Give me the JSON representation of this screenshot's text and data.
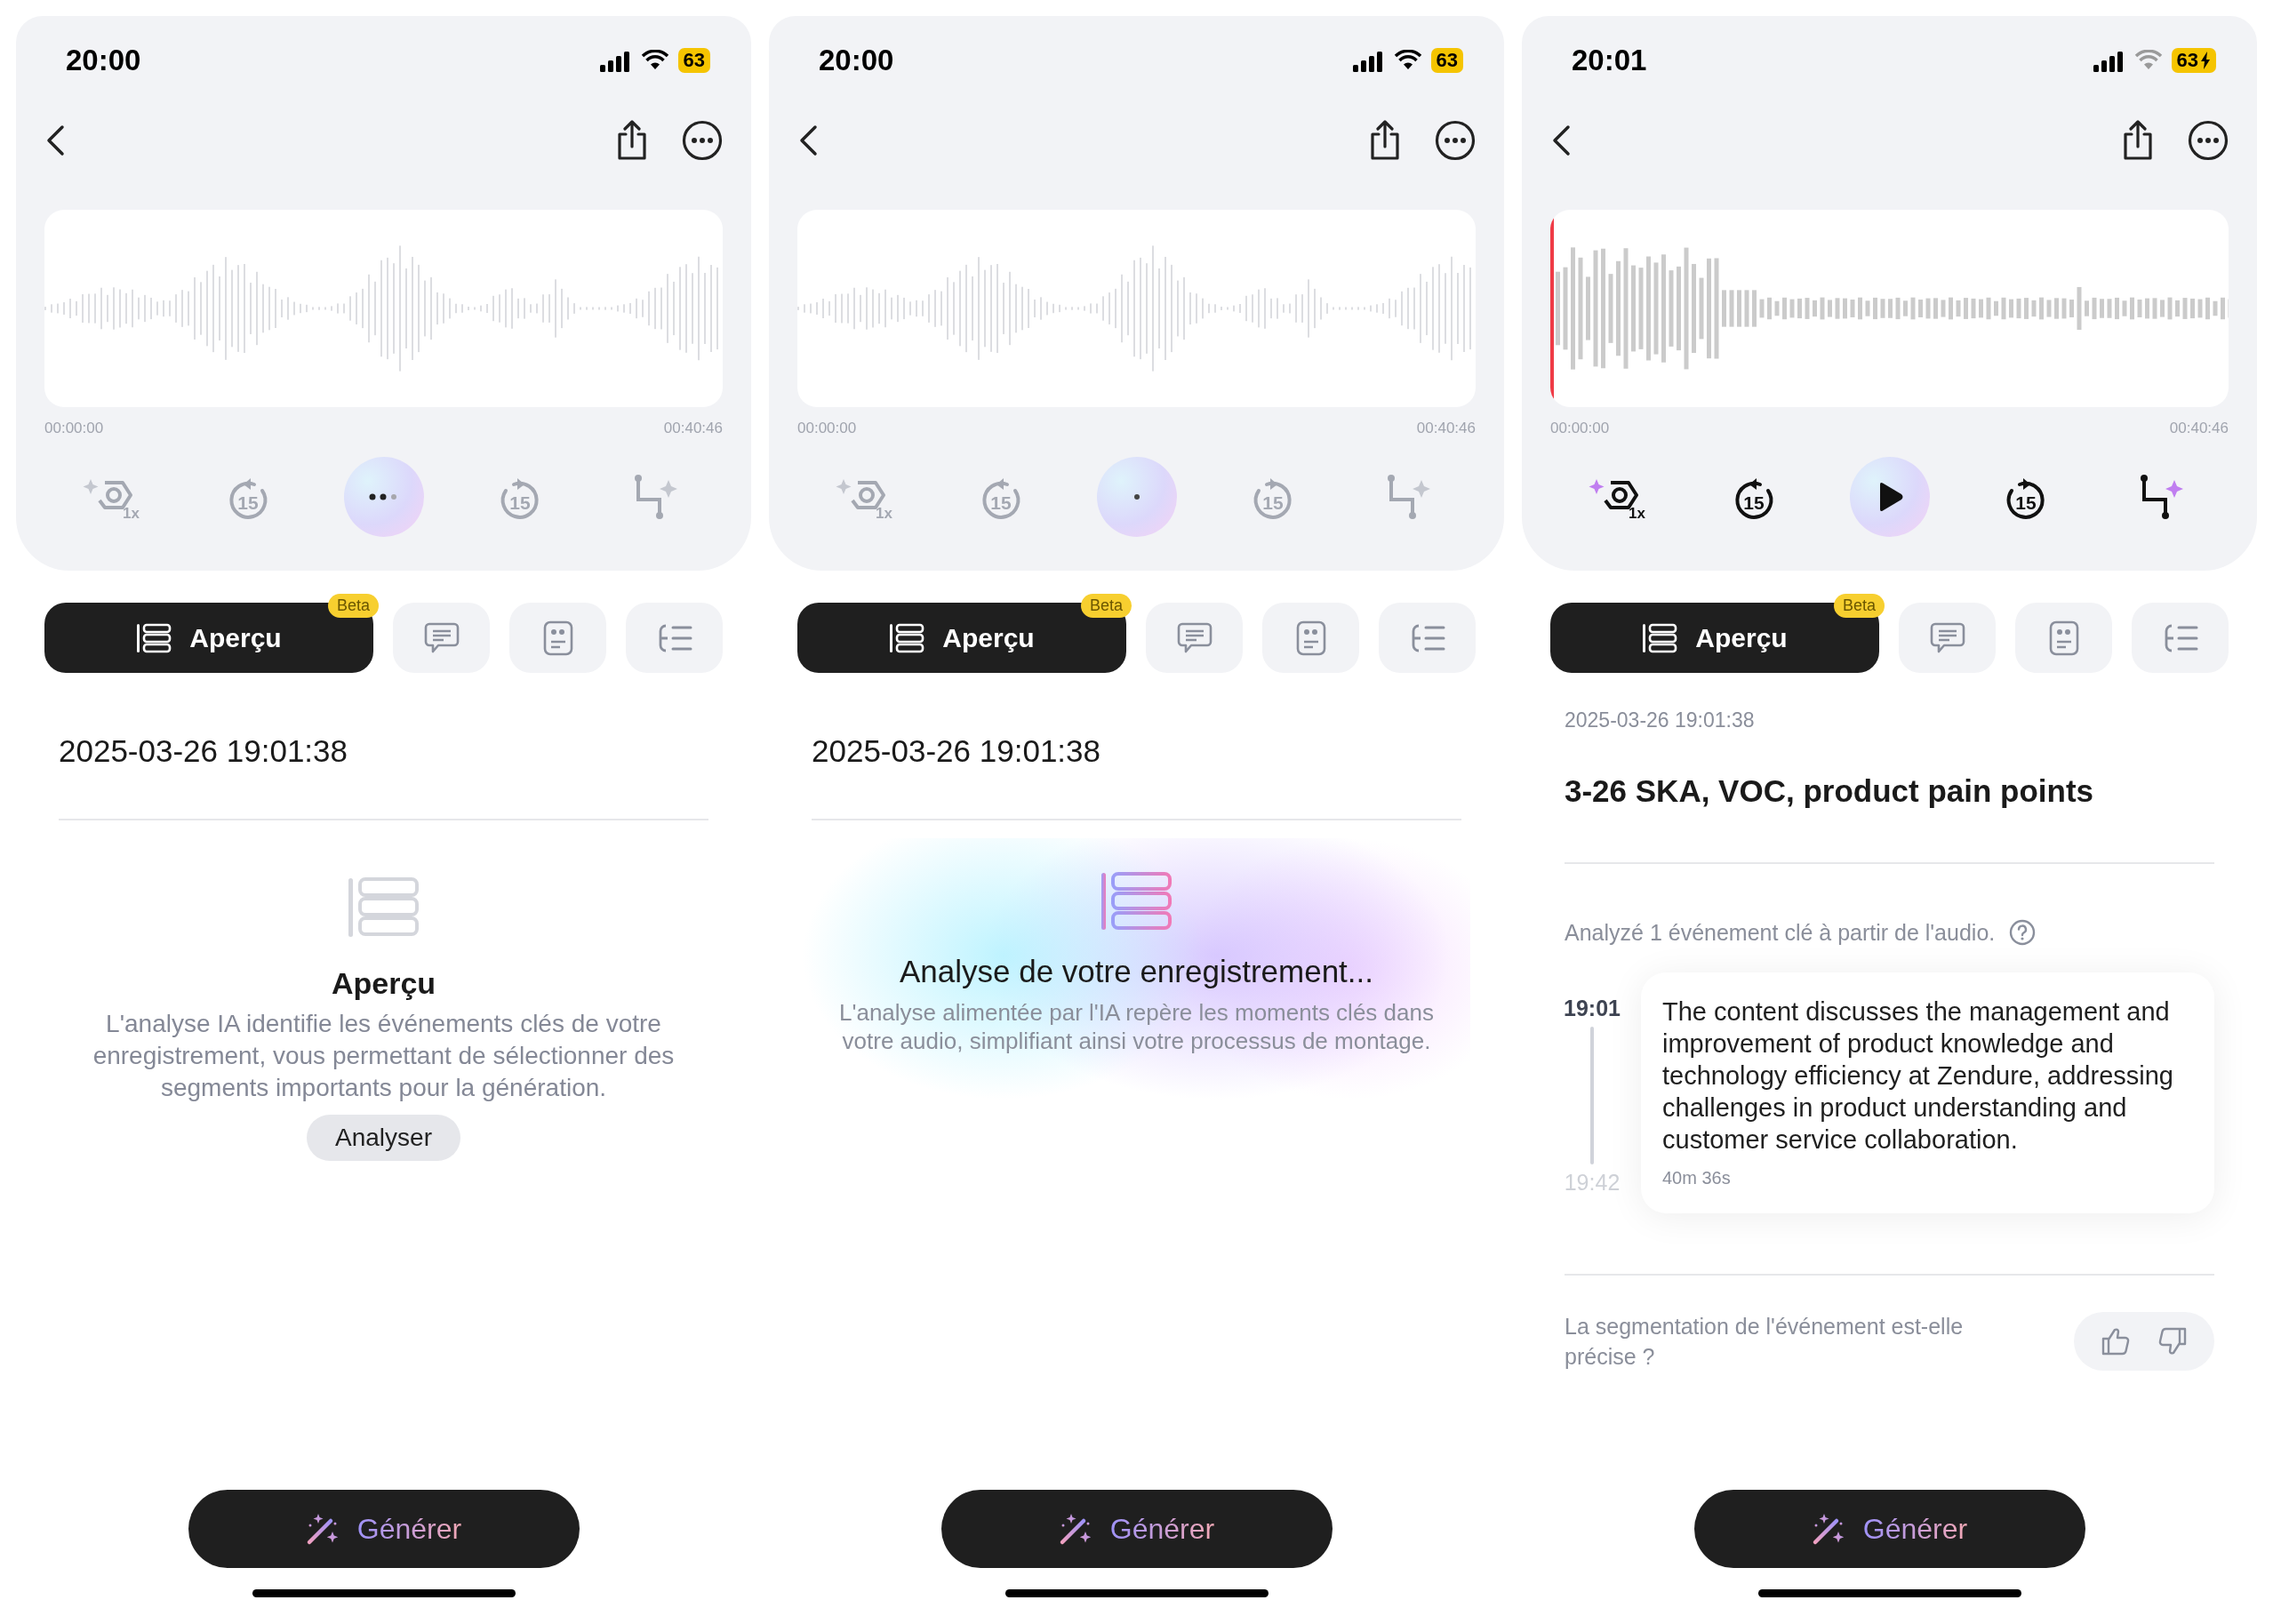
{
  "screens": [
    {
      "status": {
        "time": "20:00",
        "battery": "63",
        "charging": false
      },
      "player": {
        "enabled": false,
        "waveform": {
          "kind": "sparse",
          "playhead": false
        },
        "start_time": "00:00:00",
        "end_time": "00:40:46",
        "controls": [
          {
            "kind": "speed",
            "label": "1x"
          },
          {
            "kind": "rewind",
            "label": "15"
          },
          {
            "kind": "dots"
          },
          {
            "kind": "forward",
            "label": "15"
          },
          {
            "kind": "trim"
          }
        ]
      },
      "tabs": [
        {
          "kind": "overview",
          "label": "Aperçu",
          "badge": "Beta",
          "selected": true
        },
        {
          "kind": "chat",
          "selected": false
        },
        {
          "kind": "quote",
          "selected": false
        },
        {
          "kind": "outline",
          "selected": false
        }
      ],
      "content": {
        "kind": "empty",
        "date": "2025-03-26 19:01:38",
        "title": "Aperçu",
        "description": "L'analyse IA identifie les événements clés de votre enregistrement, vous permettant de sélectionner des segments importants pour la génération.",
        "button": "Analyser"
      },
      "generate": "Générer"
    },
    {
      "status": {
        "time": "20:00",
        "battery": "63",
        "charging": false
      },
      "player": {
        "enabled": false,
        "waveform": {
          "kind": "sparse",
          "playhead": false
        },
        "start_time": "00:00:00",
        "end_time": "00:40:46",
        "controls": [
          {
            "kind": "speed",
            "label": "1x"
          },
          {
            "kind": "rewind",
            "label": "15"
          },
          {
            "kind": "dot"
          },
          {
            "kind": "forward",
            "label": "15"
          },
          {
            "kind": "trim"
          }
        ]
      },
      "tabs": [
        {
          "kind": "overview",
          "label": "Aperçu",
          "badge": "Beta",
          "selected": true
        },
        {
          "kind": "chat",
          "selected": false
        },
        {
          "kind": "quote",
          "selected": false
        },
        {
          "kind": "outline",
          "selected": false
        }
      ],
      "content": {
        "kind": "loading",
        "date": "2025-03-26 19:01:38",
        "title": "Analyse de votre enregistrement...",
        "description": "L'analyse alimentée par l'IA repère les moments clés dans votre audio, simplifiant ainsi votre processus de montage."
      },
      "generate": "Générer"
    },
    {
      "status": {
        "time": "20:01",
        "battery": "63",
        "charging": true
      },
      "player": {
        "enabled": true,
        "waveform": {
          "kind": "dense",
          "playhead": true
        },
        "start_time": "00:00:00",
        "end_time": "00:40:46",
        "controls": [
          {
            "kind": "speed",
            "label": "1x"
          },
          {
            "kind": "rewind",
            "label": "15"
          },
          {
            "kind": "play"
          },
          {
            "kind": "forward",
            "label": "15"
          },
          {
            "kind": "trim"
          }
        ]
      },
      "tabs": [
        {
          "kind": "overview",
          "label": "Aperçu",
          "badge": "Beta",
          "selected": true
        },
        {
          "kind": "chat",
          "selected": false
        },
        {
          "kind": "quote",
          "selected": false
        },
        {
          "kind": "outline",
          "selected": false
        }
      ],
      "content": {
        "kind": "result",
        "date": "2025-03-26 19:01:38",
        "title": "3-26 SKA, VOC, product pain points",
        "note": "Analyzé 1 événement clé à partir de l'audio.",
        "events": [
          {
            "start": "19:01",
            "end": "19:42",
            "text": "The content discusses the management and improvement of product knowledge and technology efficiency at Zendure, addressing challenges in product understanding and customer service collaboration.",
            "duration": "40m 36s"
          }
        ],
        "feedback": "La segmentation de l'événement est-elle précise ?"
      },
      "generate": "Générer"
    }
  ]
}
